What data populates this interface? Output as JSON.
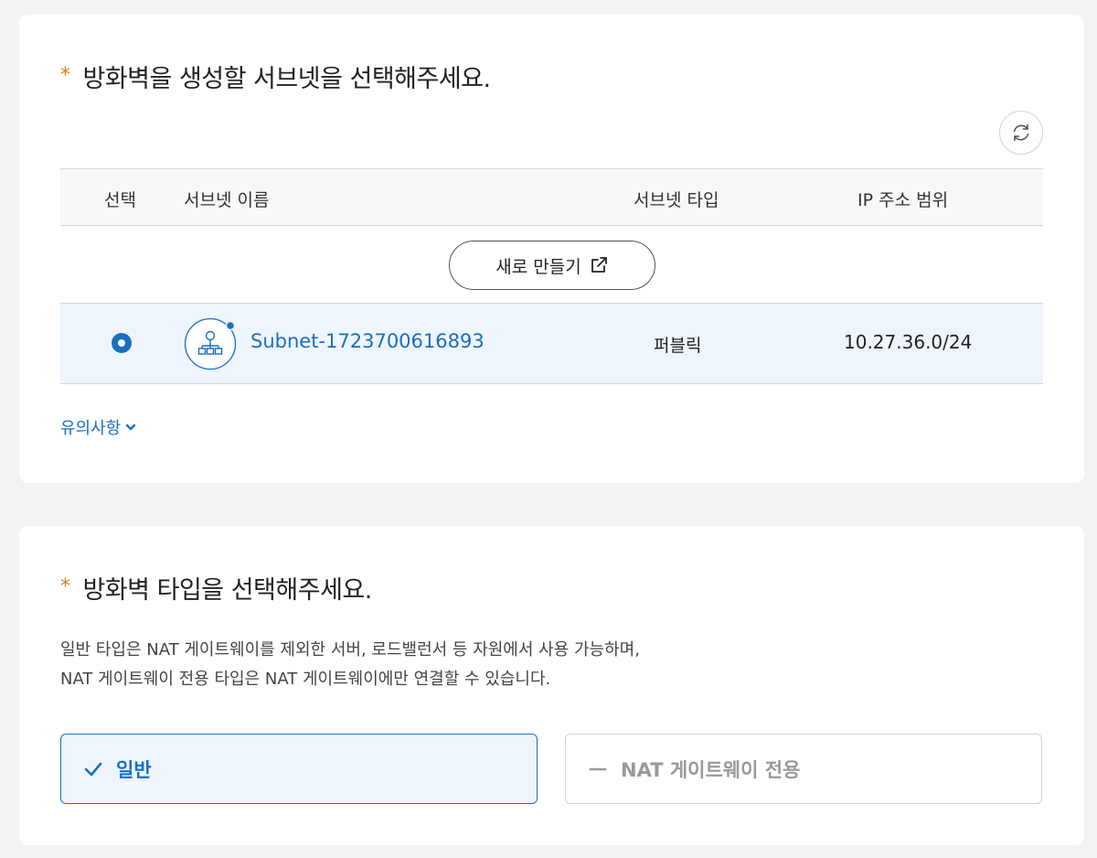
{
  "subnet_section": {
    "required_mark": "*",
    "title": "방화벽을 생성할 서브넷을 선택해주세요.",
    "refresh_icon": "refresh-icon",
    "table": {
      "headers": {
        "select": "선택",
        "name": "서브넷 이름",
        "type": "서브넷 타입",
        "ip_range": "IP 주소 범위"
      },
      "create_button": "새로 만들기",
      "rows": [
        {
          "selected": true,
          "name": "Subnet-1723700616893",
          "type": "퍼블릭",
          "ip_range": "10.27.36.0/24"
        }
      ]
    },
    "notes_toggle": "유의사항"
  },
  "type_section": {
    "required_mark": "*",
    "title": "방화벽 타입을 선택해주세요.",
    "description_line1": "일반 타입은 NAT 게이트웨이를 제외한 서버, 로드밸런서 등 자원에서 사용 가능하며,",
    "description_line2": "NAT 게이트웨이 전용 타입은 NAT 게이트웨이에만 연결할 수 있습니다.",
    "options": [
      {
        "label": "일반",
        "selected": true
      },
      {
        "label": "NAT 게이트웨이 전용",
        "selected": false
      }
    ]
  },
  "colors": {
    "accent": "#1a6fc4",
    "required": "#e07b1a",
    "selected_bg": "#eef5fc"
  }
}
